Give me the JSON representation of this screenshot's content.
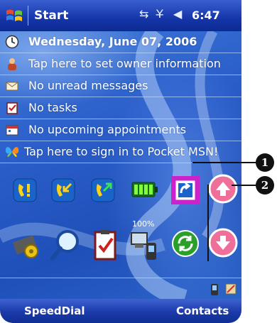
{
  "titlebar": {
    "app_title": "Start",
    "time": "6:47",
    "icons": [
      "windows-flag-icon",
      "connectivity-icon",
      "signal-off-icon",
      "volume-icon"
    ]
  },
  "today": {
    "date": "Wednesday, June 07, 2006",
    "owner": "Tap here to set owner information",
    "messages": "No unread messages",
    "tasks": "No tasks",
    "appointments": "No upcoming appointments",
    "msn": "Tap here to sign in to Pocket MSN!"
  },
  "launcher": {
    "battery_percent": "100%",
    "icons_row1": [
      "alert-phone-icon",
      "call-in-icon",
      "call-out-icon",
      "battery-icon",
      "rotate-screen-icon",
      "scroll-up-icon"
    ],
    "icons_row2": [
      "settings-chip-icon",
      "search-icon",
      "tasks-clipboard-icon",
      "sync-devices-icon",
      "refresh-icon",
      "scroll-down-icon"
    ]
  },
  "callouts": {
    "one": "1",
    "two": "2"
  },
  "softkeys": {
    "left": "SpeedDial",
    "right": "Contacts"
  },
  "colors": {
    "titlebar": "#1535a8",
    "background": "#2a5cc8",
    "highlight": "#cc22cc",
    "scroll_button": "#f06e9a"
  }
}
